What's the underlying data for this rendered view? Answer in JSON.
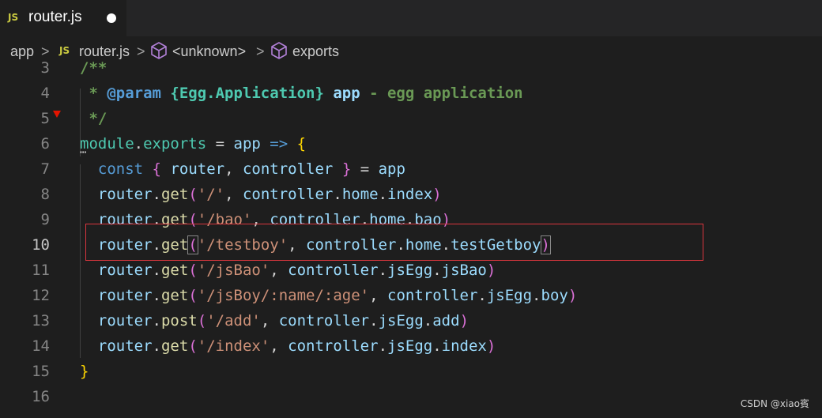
{
  "tab": {
    "badge": "JS",
    "label": "router.js"
  },
  "breadcrumb": {
    "segments": [
      "app",
      "router.js",
      "<unknown>",
      "exports"
    ],
    "separator": ">",
    "icons": [
      "js-file-icon",
      "symbol-cube-icon"
    ]
  },
  "editor": {
    "lines": [
      {
        "num": "3"
      },
      {
        "num": "4"
      },
      {
        "num": "5"
      },
      {
        "num": "6"
      },
      {
        "num": "7"
      },
      {
        "num": "8"
      },
      {
        "num": "9"
      },
      {
        "num": "10"
      },
      {
        "num": "11"
      },
      {
        "num": "12"
      },
      {
        "num": "13"
      },
      {
        "num": "14"
      },
      {
        "num": "15"
      },
      {
        "num": "16"
      }
    ],
    "active_line": "10"
  },
  "watermark": "CSDN @xiao賓",
  "colors": {
    "background": "#1e1e1e",
    "tabbar": "#252526",
    "line_number": "#858585",
    "variable": "#9cdcfe",
    "function": "#dcdcaa",
    "string": "#ce9178",
    "keyword": "#569cd6",
    "comment": "#6a9955",
    "highlight_box": "#d9363e"
  }
}
